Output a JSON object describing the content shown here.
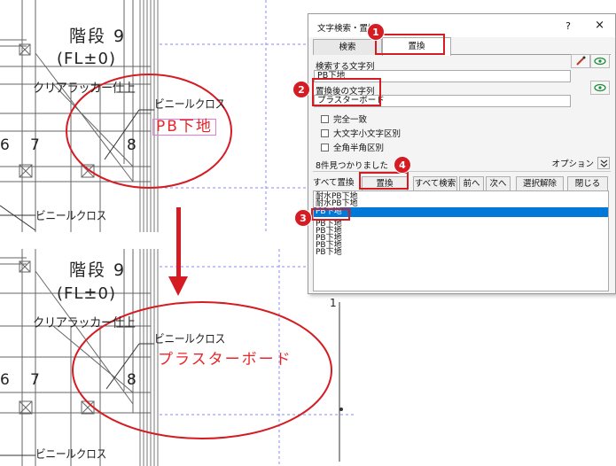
{
  "cad_top": {
    "stair_label": "階段 9",
    "floor_level": "(FL±0)",
    "finish_label": "クリアラッカー仕上",
    "vinyl_label_1": "ビニールクロス",
    "vinyl_label_2": "ビニールクロス",
    "old_text": "PB下地",
    "num_6": "6",
    "num_7": "7",
    "num_8": "8"
  },
  "cad_bottom": {
    "stair_label": "階段 9",
    "floor_level": "(FL±0)",
    "finish_label": "クリアラッカー仕上",
    "vinyl_label_1": "ビニールクロス",
    "vinyl_label_2": "ビニールクロス",
    "new_text": "プラスターボード",
    "num_6": "6",
    "num_7": "7",
    "num_8": "8",
    "num_1": "1"
  },
  "dialog": {
    "title": "文字検索・置換",
    "help": "?",
    "close": "×",
    "tabs": {
      "search": "検索",
      "replace": "置換"
    },
    "search_label": "検索する文字列",
    "search_value": "PB下地",
    "replace_label": "置換後の文字列",
    "replace_value": "プラスターボード",
    "options": {
      "exact_match": "完全一致",
      "case_sensitive": "大文字小文字区別",
      "width_sensitive": "全角半角区別"
    },
    "status": "8件見つかりました",
    "option_button": "オプション",
    "buttons": {
      "replace_all": "すべて置換",
      "replace": "置換",
      "search_all": "すべて検索",
      "prev": "前へ",
      "next": "次へ",
      "deselect": "選択解除",
      "close": "閉じる"
    },
    "results": [
      "耐水PB下地",
      "耐水PB下地",
      "PB下地",
      "PB下地",
      "PB下地",
      "PB下地",
      "PB下地",
      "PB下地"
    ]
  },
  "callouts": [
    "1",
    "2",
    "3",
    "4"
  ],
  "colors": {
    "accent_red": "#d61c23",
    "cad_text_red": "#e8262a",
    "highlight_magenta": "#e07bd8",
    "selection_blue": "#0078d7",
    "guide_blue": "#6a6aff"
  },
  "icons": {
    "pick": "pick-text-icon",
    "eye": "preview-eye-icon",
    "chevron": "chevron-double-down-icon",
    "arrow": "down-arrow-icon"
  }
}
